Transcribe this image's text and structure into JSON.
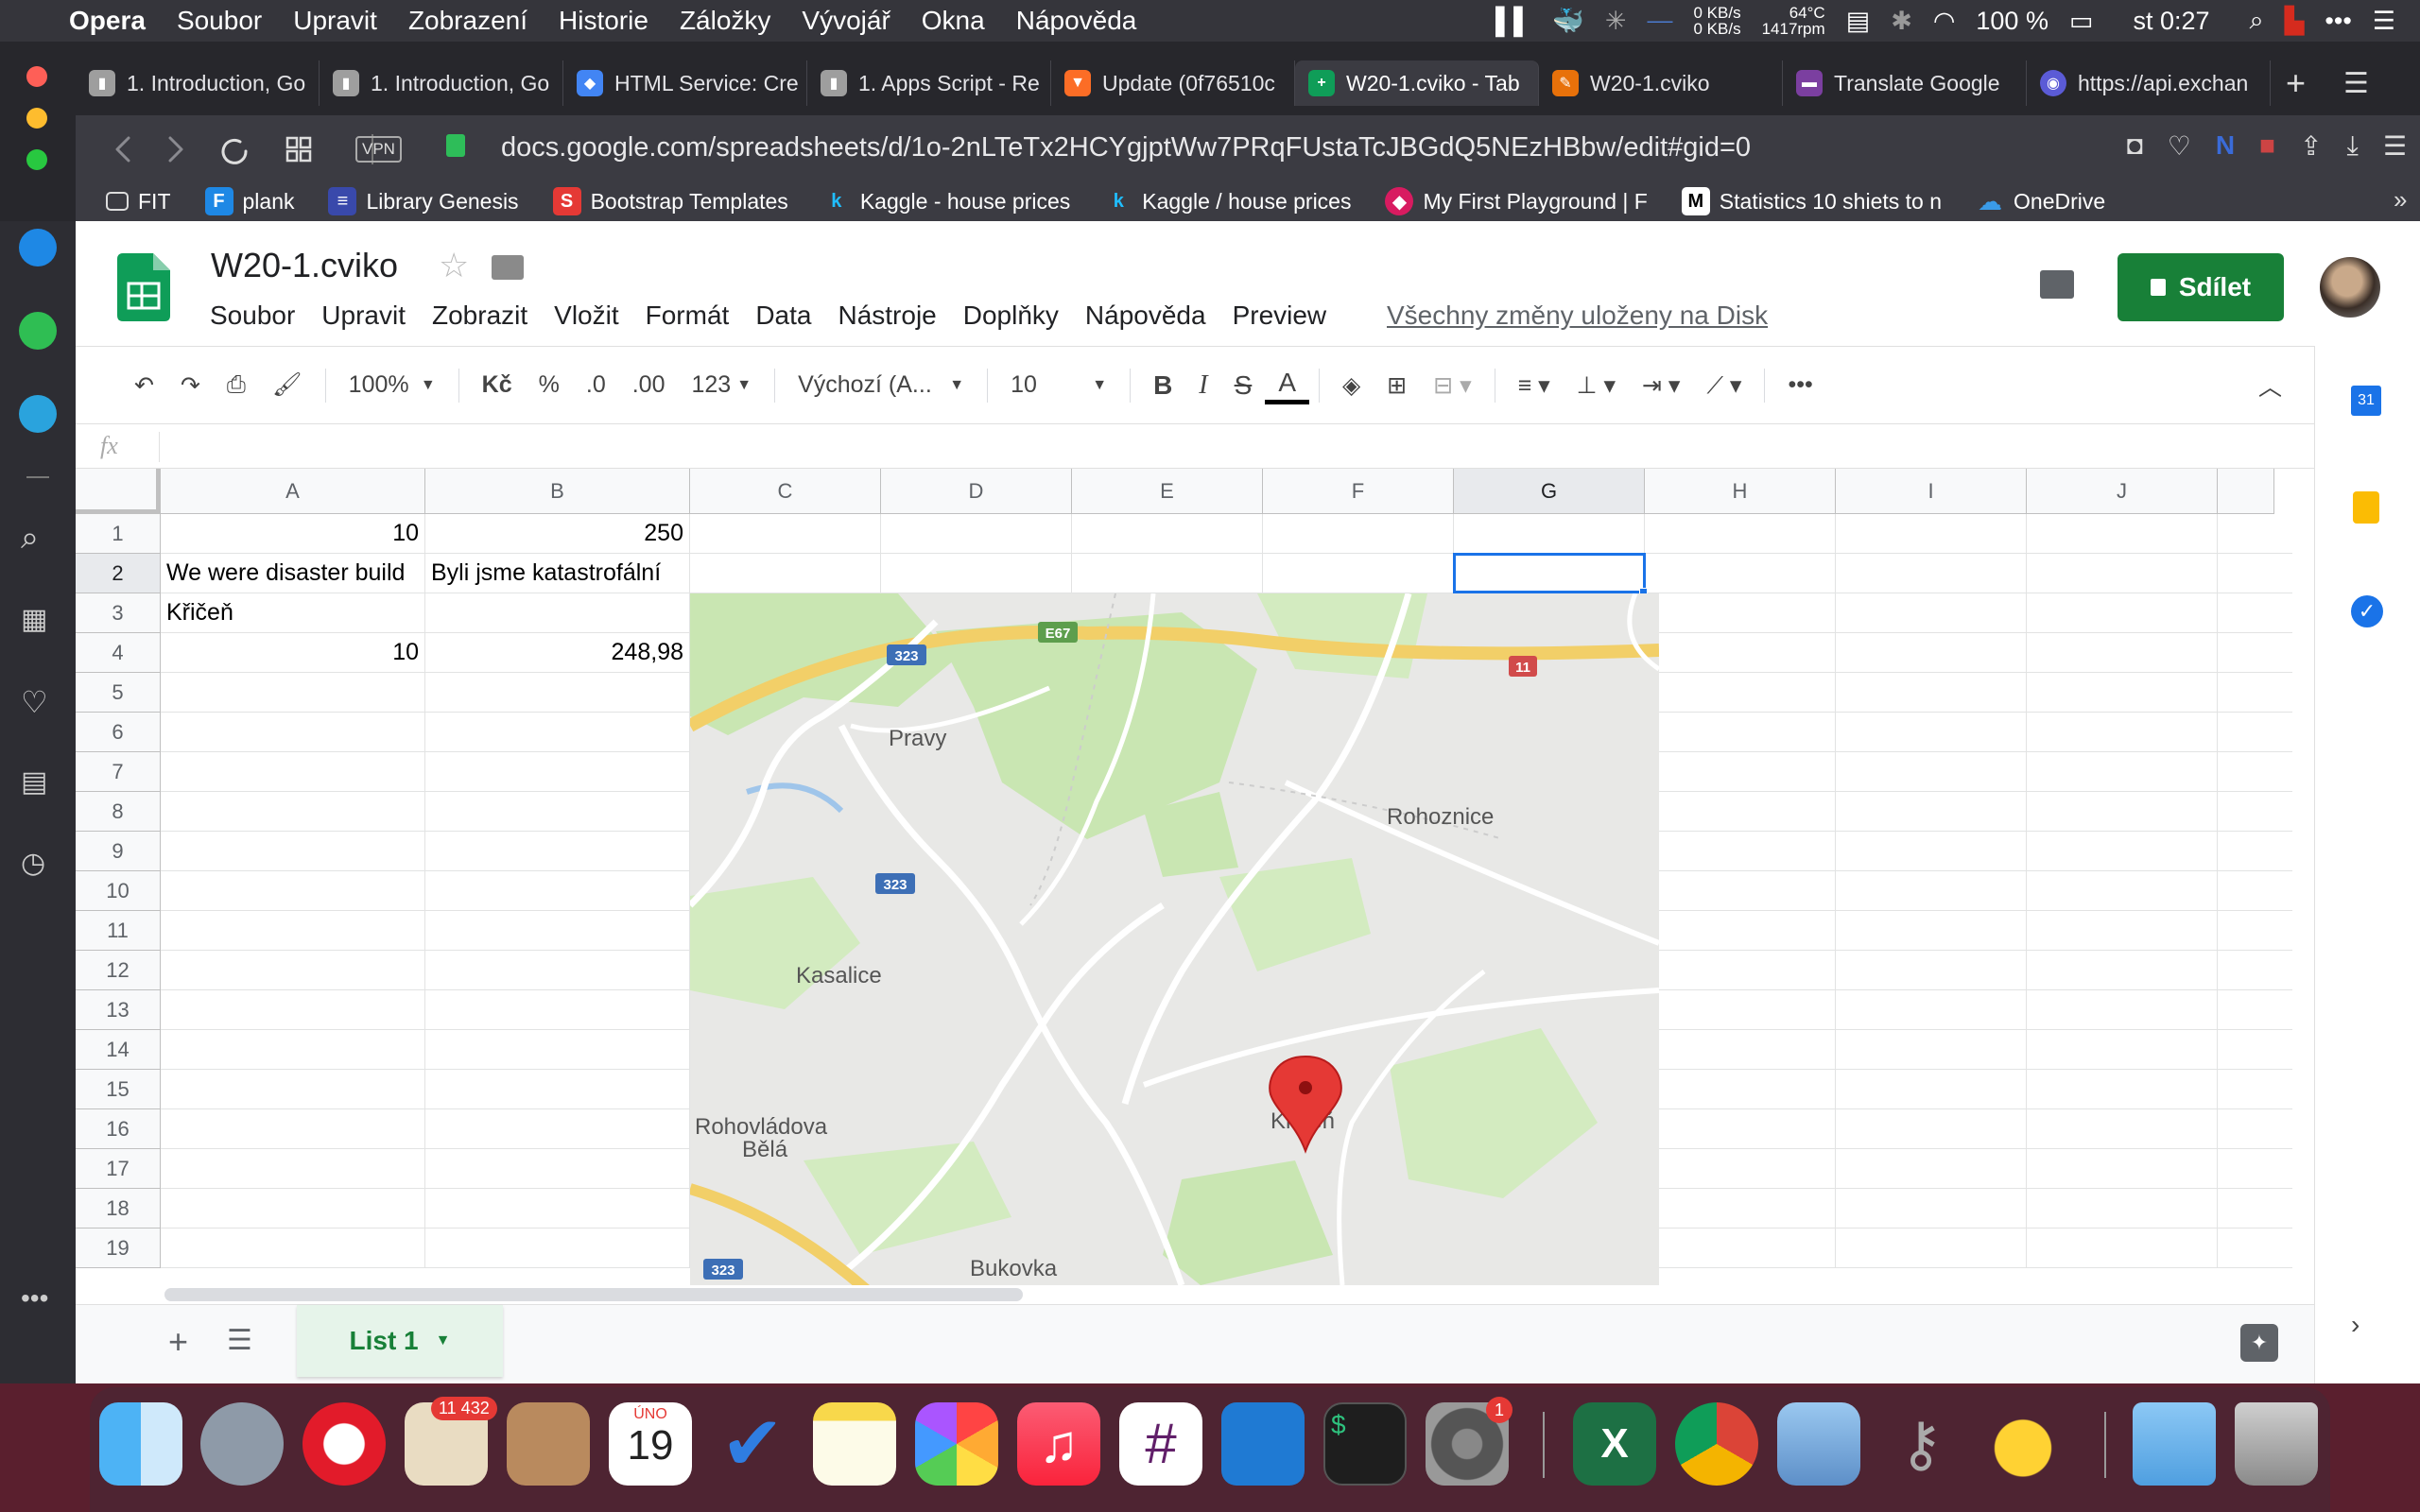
{
  "menubar": {
    "app": "Opera",
    "items": [
      "Soubor",
      "Upravit",
      "Zobrazení",
      "Historie",
      "Záložky",
      "Vývojář",
      "Okna",
      "Nápověda"
    ],
    "net_up": "0 KB/s",
    "net_down": "0 KB/s",
    "temp": "64°C",
    "rpm": "1417rpm",
    "battery": "100 %",
    "clock": "st 0:27"
  },
  "tabs": [
    {
      "label": "1. Introduction, Go",
      "color": "#9e9e9e"
    },
    {
      "label": "1. Introduction, Go",
      "color": "#9e9e9e"
    },
    {
      "label": "HTML Service: Cre",
      "color": "#4285f4"
    },
    {
      "label": "1. Apps Script - Re",
      "color": "#9e9e9e"
    },
    {
      "label": "Update (0f76510c",
      "color": "#fc6d26"
    },
    {
      "label": "W20-1.cviko - Tab",
      "color": "#0f9d58"
    },
    {
      "label": "W20-1.cviko",
      "color": "#e8710a"
    },
    {
      "label": "Translate Google",
      "color": "#7b3fa0"
    },
    {
      "label": "https://api.exchan",
      "color": "#5b5bd6"
    }
  ],
  "address": {
    "vpn": "VPN",
    "url": "docs.google.com/spreadsheets/d/1o-2nLTeTx2HCYgjptWw7PRqFUstaTcJBGdQ5NEzHBbw/edit#gid=0"
  },
  "bookmarks": [
    {
      "label": "FIT",
      "icon": "folder-icon",
      "color": "#3b3b42",
      "glyph": "▭"
    },
    {
      "label": "plank",
      "icon": "plank-icon",
      "color": "#1e88e5",
      "glyph": "F"
    },
    {
      "label": "Library Genesis",
      "icon": "libgen-icon",
      "color": "#3949ab",
      "glyph": "≡"
    },
    {
      "label": "Bootstrap Templates",
      "icon": "bootstrap-icon",
      "color": "#e53935",
      "glyph": "S"
    },
    {
      "label": "Kaggle - house prices",
      "icon": "kaggle-icon",
      "color": "#3b3b42",
      "glyph": "k"
    },
    {
      "label": "Kaggle / house prices",
      "icon": "kaggle-icon",
      "color": "#3b3b42",
      "glyph": "k"
    },
    {
      "label": "My First Playground | F",
      "icon": "playground-icon",
      "color": "#d81b60",
      "glyph": "◆"
    },
    {
      "label": "Statistics 10 shiets to n",
      "icon": "medium-icon",
      "color": "#000000",
      "glyph": "M"
    },
    {
      "label": "OneDrive",
      "icon": "onedrive-icon",
      "color": "#3b3b42",
      "glyph": "☁"
    }
  ],
  "doc": {
    "title": "W20-1.cviko",
    "menu": [
      "Soubor",
      "Upravit",
      "Zobrazit",
      "Vložit",
      "Formát",
      "Data",
      "Nástroje",
      "Doplňky",
      "Nápověda",
      "Preview"
    ],
    "saved": "Všechny změny uloženy na Disk",
    "share": "Sdílet"
  },
  "toolbar": {
    "zoom": "100%",
    "currency": "Kč",
    "percent": "%",
    "dec_less": ".0",
    "dec_more": ".00",
    "format": "123",
    "font": "Výchozí (A...",
    "size": "10",
    "bold": "B",
    "italic": "I",
    "strike": "S",
    "color": "A"
  },
  "formula": {
    "fx": "fx",
    "value": ""
  },
  "grid": {
    "columns": [
      "A",
      "B",
      "C",
      "D",
      "E",
      "F",
      "G",
      "H",
      "I",
      "J"
    ],
    "rows": [
      "1",
      "2",
      "3",
      "4",
      "5",
      "6",
      "7",
      "8",
      "9",
      "10",
      "11",
      "12",
      "13",
      "14",
      "15",
      "16",
      "17",
      "18",
      "19"
    ],
    "cells": {
      "A1": "10",
      "B1": "250",
      "A2": "We were disaster build",
      "B2": "Byli jsme katastrofální",
      "A3": "Křičeň",
      "A4": "10",
      "B4": "248,98"
    },
    "selected": "G2"
  },
  "map": {
    "places": [
      "Pravy",
      "Rohoznice",
      "Kasalice",
      "Rohovládova",
      "Bělá",
      "Bukovka",
      "Křičeň"
    ],
    "shields": [
      "E67",
      "323",
      "323",
      "323",
      "11"
    ]
  },
  "sheet": {
    "tab": "List 1",
    "add": "+"
  },
  "side_right": {
    "calendar": "31"
  },
  "dock": {
    "mail_badge": "11 432",
    "calendar_month": "ÚNO",
    "calendar_day": "19",
    "settings_badge": "1",
    "excel": "X",
    "terminal": "$"
  }
}
